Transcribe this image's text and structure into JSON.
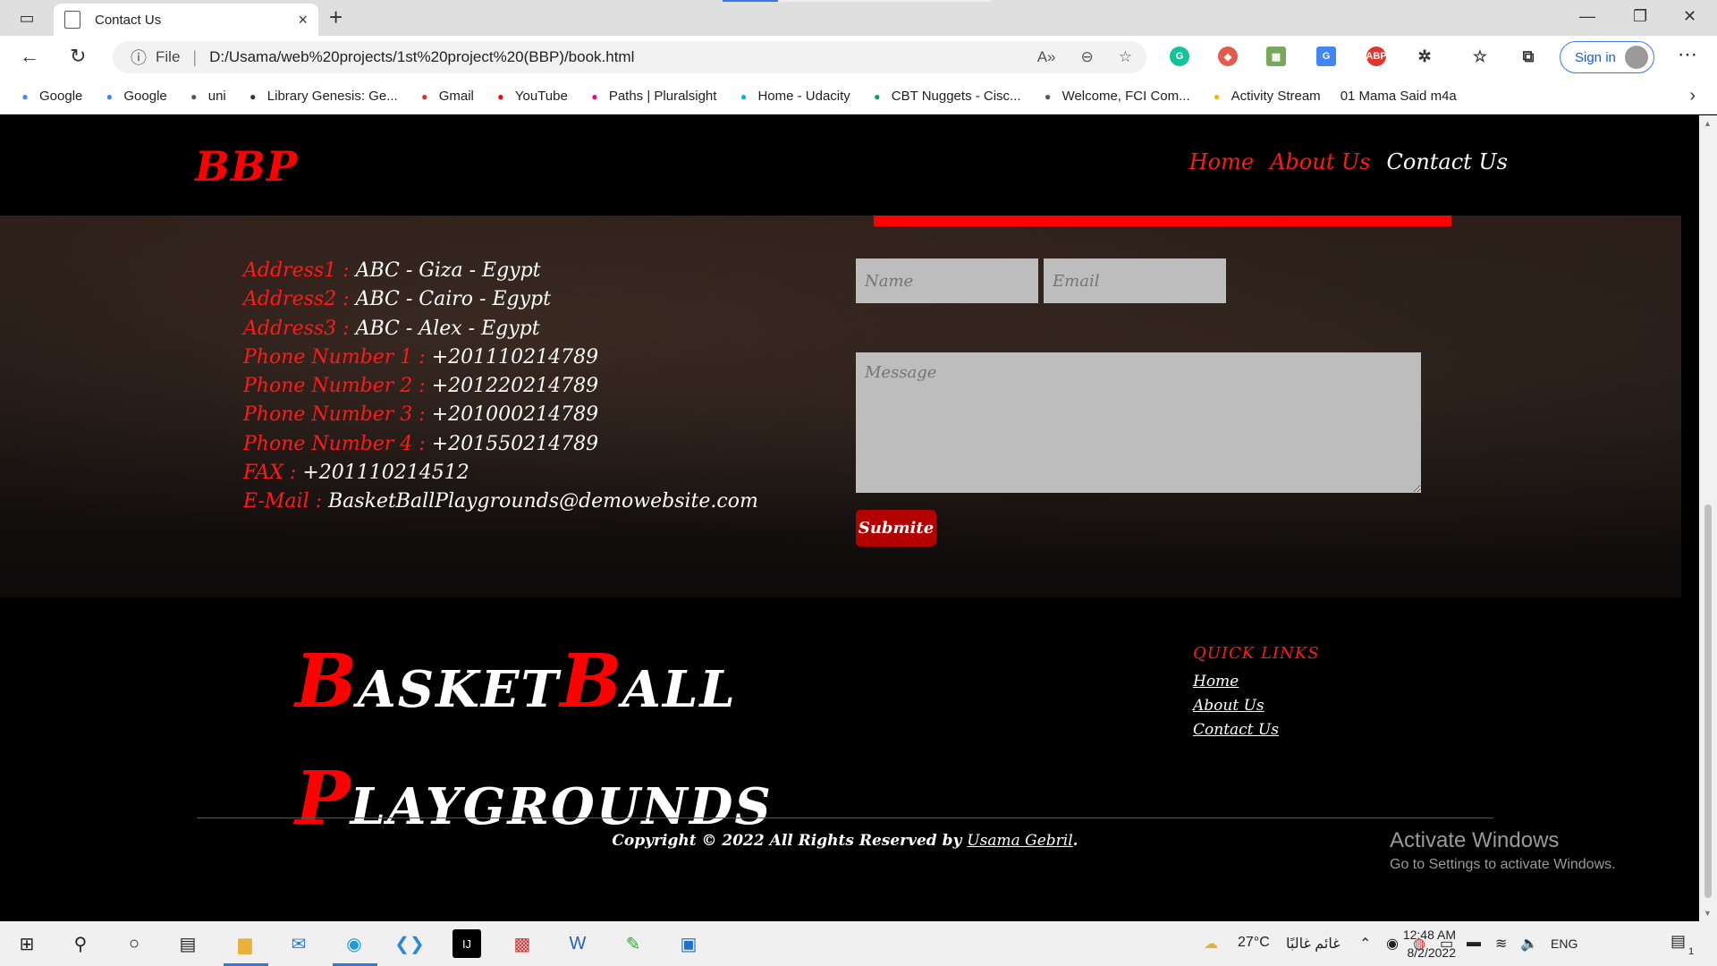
{
  "browser": {
    "tab_title": "Contact Us",
    "new_tab": "+",
    "tab_close": "×",
    "url_scheme_label": "File",
    "url": "D:/Usama/web%20projects/1st%20project%20(BBP)/book.html",
    "sign_in": "Sign in",
    "bookmarks": [
      {
        "label": "Google",
        "icon": "google-icon",
        "color": "#4285f4"
      },
      {
        "label": "Google",
        "icon": "google-icon",
        "color": "#4285f4"
      },
      {
        "label": "uni",
        "icon": "uni-icon",
        "color": "#556"
      },
      {
        "label": "Library Genesis: Ge...",
        "icon": "library-icon",
        "color": "#334"
      },
      {
        "label": "Gmail",
        "icon": "gmail-icon",
        "color": "#d93025"
      },
      {
        "label": "YouTube",
        "icon": "youtube-icon",
        "color": "#f00"
      },
      {
        "label": "Paths | Pluralsight",
        "icon": "pluralsight-icon",
        "color": "#e80a89"
      },
      {
        "label": "Home - Udacity",
        "icon": "udacity-icon",
        "color": "#02b3e4"
      },
      {
        "label": "CBT Nuggets - Cisc...",
        "icon": "drive-icon",
        "color": "#0f9d58"
      },
      {
        "label": "Welcome, FCI Com...",
        "icon": "fci-icon",
        "color": "#556"
      },
      {
        "label": "Activity Stream",
        "icon": "activity-icon",
        "color": "#f4b400"
      },
      {
        "label": "01 Mama Said m4a",
        "icon": "",
        "color": ""
      }
    ]
  },
  "site": {
    "brand": "BBP",
    "nav": [
      {
        "label": "Home",
        "color": "#ff1a1a"
      },
      {
        "label": "About Us",
        "color": "#ff1a1a"
      },
      {
        "label": "Contact Us",
        "color": "#ffffff"
      }
    ],
    "contact": [
      {
        "label": "Address1 : ",
        "value": "ABC - Giza - Egypt"
      },
      {
        "label": "Address2 : ",
        "value": "ABC - Cairo - Egypt"
      },
      {
        "label": "Address3 : ",
        "value": "ABC - Alex - Egypt"
      },
      {
        "label": "Phone Number 1 : ",
        "value": "+201110214789"
      },
      {
        "label": "Phone Number 2 : ",
        "value": "+201220214789"
      },
      {
        "label": "Phone Number 3 : ",
        "value": "+201000214789"
      },
      {
        "label": "Phone Number 4 : ",
        "value": "+201550214789"
      },
      {
        "label": "FAX : ",
        "value": "+201110214512"
      },
      {
        "label": "E-Mail : ",
        "value": "BasketBallPlaygrounds@demowebsite.com"
      }
    ],
    "form": {
      "name_placeholder": "Name",
      "email_placeholder": "Email",
      "message_placeholder": "Message",
      "submit_label": "Submite"
    },
    "footer": {
      "logo_line1": [
        {
          "text": "B",
          "red": true,
          "big": true
        },
        {
          "text": "ASKET",
          "red": false,
          "big": false
        },
        {
          "text": "B",
          "red": true,
          "big": true
        },
        {
          "text": "ALL",
          "red": false,
          "big": false
        }
      ],
      "logo_line2": [
        {
          "text": "P",
          "red": true,
          "big": true
        },
        {
          "text": "LAYGROUNDS",
          "red": false,
          "big": false
        }
      ],
      "quick_links_title": "QUICK LINKS",
      "quick_links": [
        "Home",
        "About Us",
        "Contact Us"
      ],
      "copyright_prefix": "Copyright © 2022 All Rights Reserved by ",
      "copyright_author": "Usama Gebril",
      "copyright_suffix": "."
    }
  },
  "watermark": {
    "title": "Activate Windows",
    "subtitle": "Go to Settings to activate Windows."
  },
  "taskbar": {
    "weather": "27°C",
    "weather_text": "غائم غالبًا",
    "language": "ENG",
    "time": "12:48 AM",
    "date": "8/2/2022",
    "notification_count": "1"
  }
}
